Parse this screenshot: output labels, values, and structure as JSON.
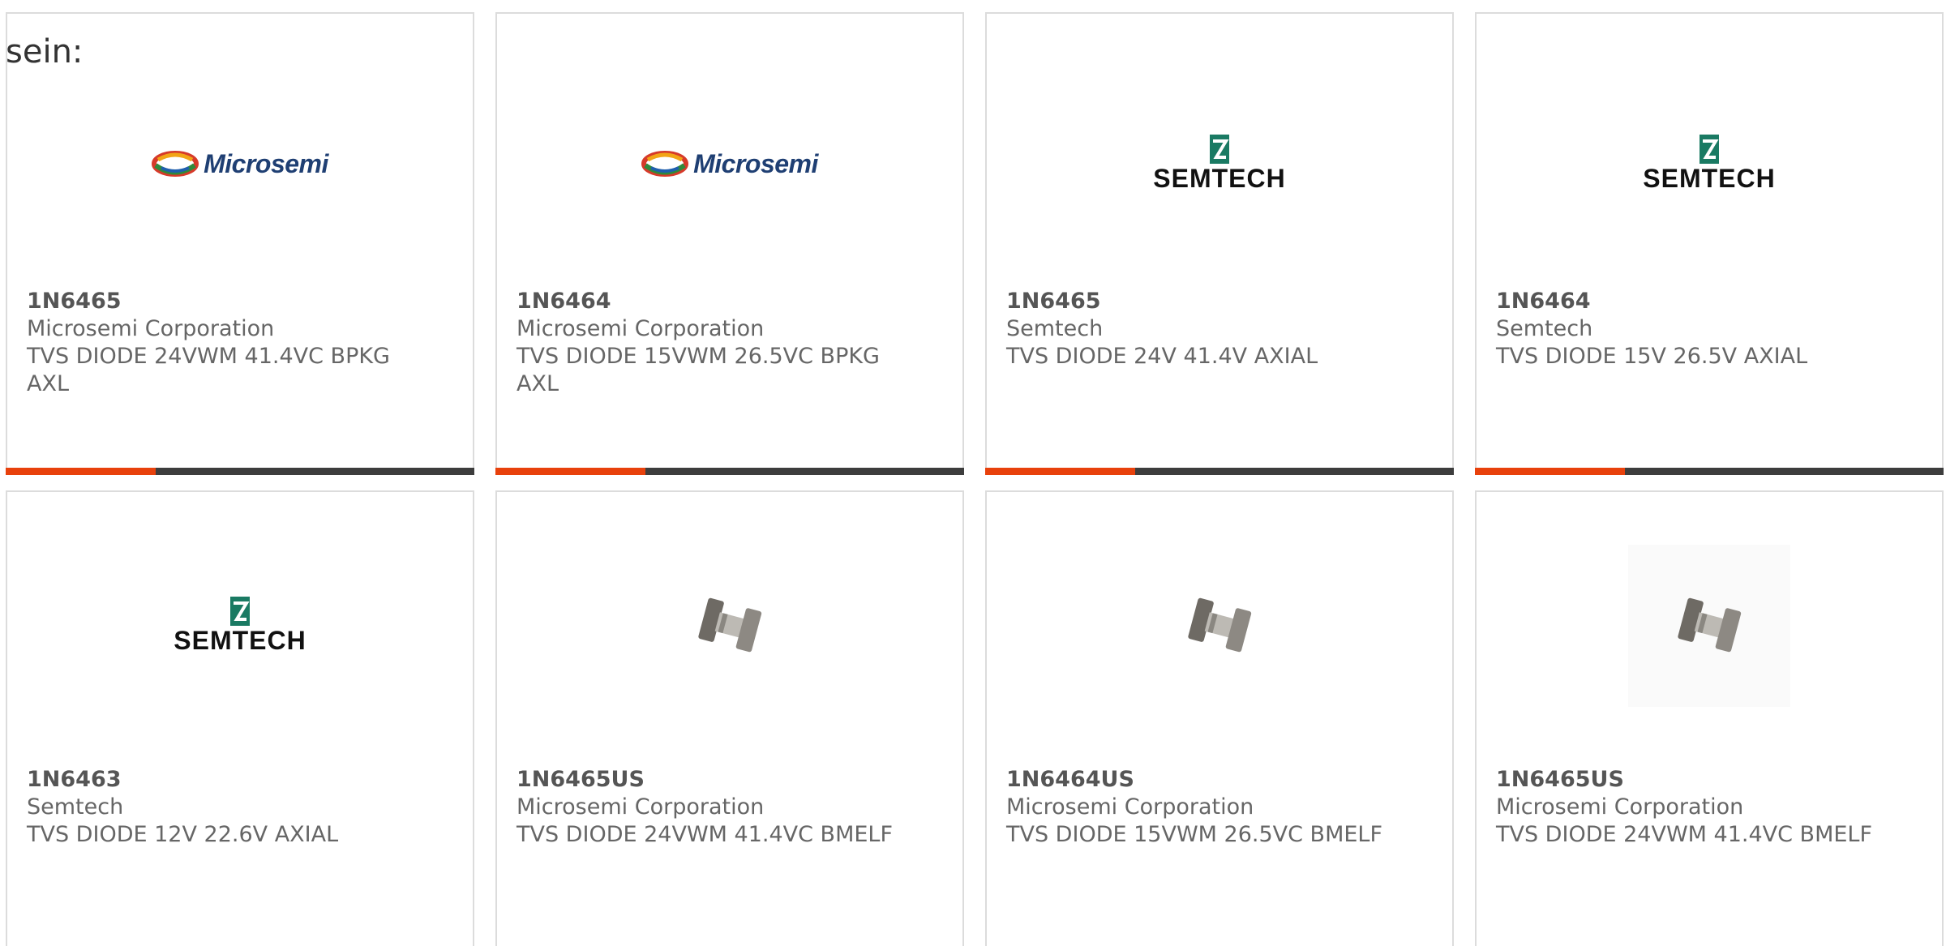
{
  "intro_text": "sein:",
  "colors": {
    "progress_fill": "#e8410c",
    "progress_track": "#3d3d3d",
    "card_border": "#dcdcdc",
    "text": "#666666"
  },
  "cards": [
    {
      "part_number": "1N6465",
      "manufacturer": "Microsemi Corporation",
      "description": "TVS DIODE 24VWM 41.4VC BPKG AXL",
      "logo_text": "Microsemi",
      "image": "microsemi-logo",
      "progress": 0.32
    },
    {
      "part_number": "1N6464",
      "manufacturer": "Microsemi Corporation",
      "description": "TVS DIODE 15VWM 26.5VC BPKG AXL",
      "logo_text": "Microsemi",
      "image": "microsemi-logo",
      "progress": 0.32
    },
    {
      "part_number": "1N6465",
      "manufacturer": "Semtech",
      "description": "TVS DIODE 24V 41.4V AXIAL",
      "logo_text": "SEMTECH",
      "image": "semtech-logo",
      "progress": 0.32
    },
    {
      "part_number": "1N6464",
      "manufacturer": "Semtech",
      "description": "TVS DIODE 15V 26.5V AXIAL",
      "logo_text": "SEMTECH",
      "image": "semtech-logo",
      "progress": 0.32
    },
    {
      "part_number": "1N6463",
      "manufacturer": "Semtech",
      "description": "TVS DIODE 12V 22.6V AXIAL",
      "logo_text": "SEMTECH",
      "image": "semtech-logo"
    },
    {
      "part_number": "1N6465US",
      "manufacturer": "Microsemi Corporation",
      "description": "TVS DIODE 24VWM 41.4VC BMELF",
      "image": "diode-component-image"
    },
    {
      "part_number": "1N6464US",
      "manufacturer": "Microsemi Corporation",
      "description": "TVS DIODE 15VWM 26.5VC BMELF",
      "image": "diode-component-image"
    },
    {
      "part_number": "1N6465US",
      "manufacturer": "Microsemi Corporation",
      "description": "TVS DIODE 24VWM 41.4VC BMELF",
      "image": "diode-component-image"
    }
  ]
}
